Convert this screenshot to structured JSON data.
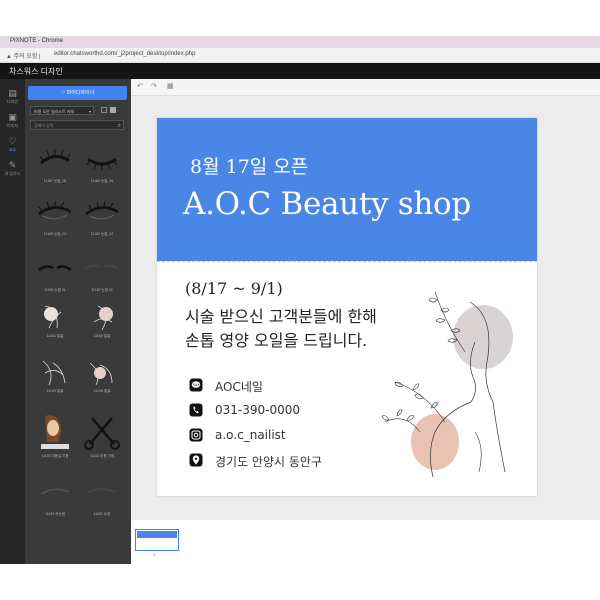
{
  "window": {
    "title": "PIXNOTE - Chrome",
    "security_label": "주의 요함",
    "url": "editor.chatsworthd.com/_j2project_desktop/index.php"
  },
  "app": {
    "brand": "차스워스 디자인"
  },
  "nav": {
    "items": [
      {
        "label": "디자인",
        "icon": "template-icon"
      },
      {
        "label": "이미지",
        "icon": "photo-icon"
      },
      {
        "label": "요소",
        "icon": "heart-icon"
      },
      {
        "label": "내 업로드",
        "icon": "pen-icon"
      }
    ]
  },
  "panel": {
    "designer_button": "♡ 마이디자이너",
    "category_value": "미용 도안 일러스트 카테",
    "search_placeholder": "검색어 입력",
    "thumbnails": [
      {
        "caption": "11167 눈썹_05"
      },
      {
        "caption": "11166 눈썹_06"
      },
      {
        "caption": "11165 눈썹_03"
      },
      {
        "caption": "11164 눈썹_02"
      },
      {
        "caption": "11163 눈썹 01"
      },
      {
        "caption": "11162 눈썹 02"
      },
      {
        "caption": "11161 얼굴"
      },
      {
        "caption": "11160 얼굴"
      },
      {
        "caption": "11159 얼굴"
      },
      {
        "caption": "11158 얼굴"
      },
      {
        "caption": "11155 미용실 미용"
      },
      {
        "caption": "11154 미용 가위"
      },
      {
        "caption": "11152 속눈썹"
      },
      {
        "caption": "11151 눈썹"
      }
    ]
  },
  "canvas": {
    "date_line": "8월 17일 오픈",
    "shop_name": "A.O.C Beauty shop",
    "period": "(8/17 ~ 9/1)",
    "body_line1": "시술 받으신 고객분들에 한해",
    "body_line2": "손톱 영양 오일을 드립니다.",
    "contacts": [
      {
        "icon": "kakaotalk-icon",
        "text": "AOC네일"
      },
      {
        "icon": "phone-icon",
        "text": "031-390-0000"
      },
      {
        "icon": "instagram-icon",
        "text": "a.o.c_nailist"
      },
      {
        "icon": "location-icon",
        "text": "경기도 안양시 동안구"
      }
    ]
  },
  "pages": {
    "current": "1"
  },
  "colors": {
    "banner": "#4a86e5",
    "accent": "#3f82f0"
  }
}
